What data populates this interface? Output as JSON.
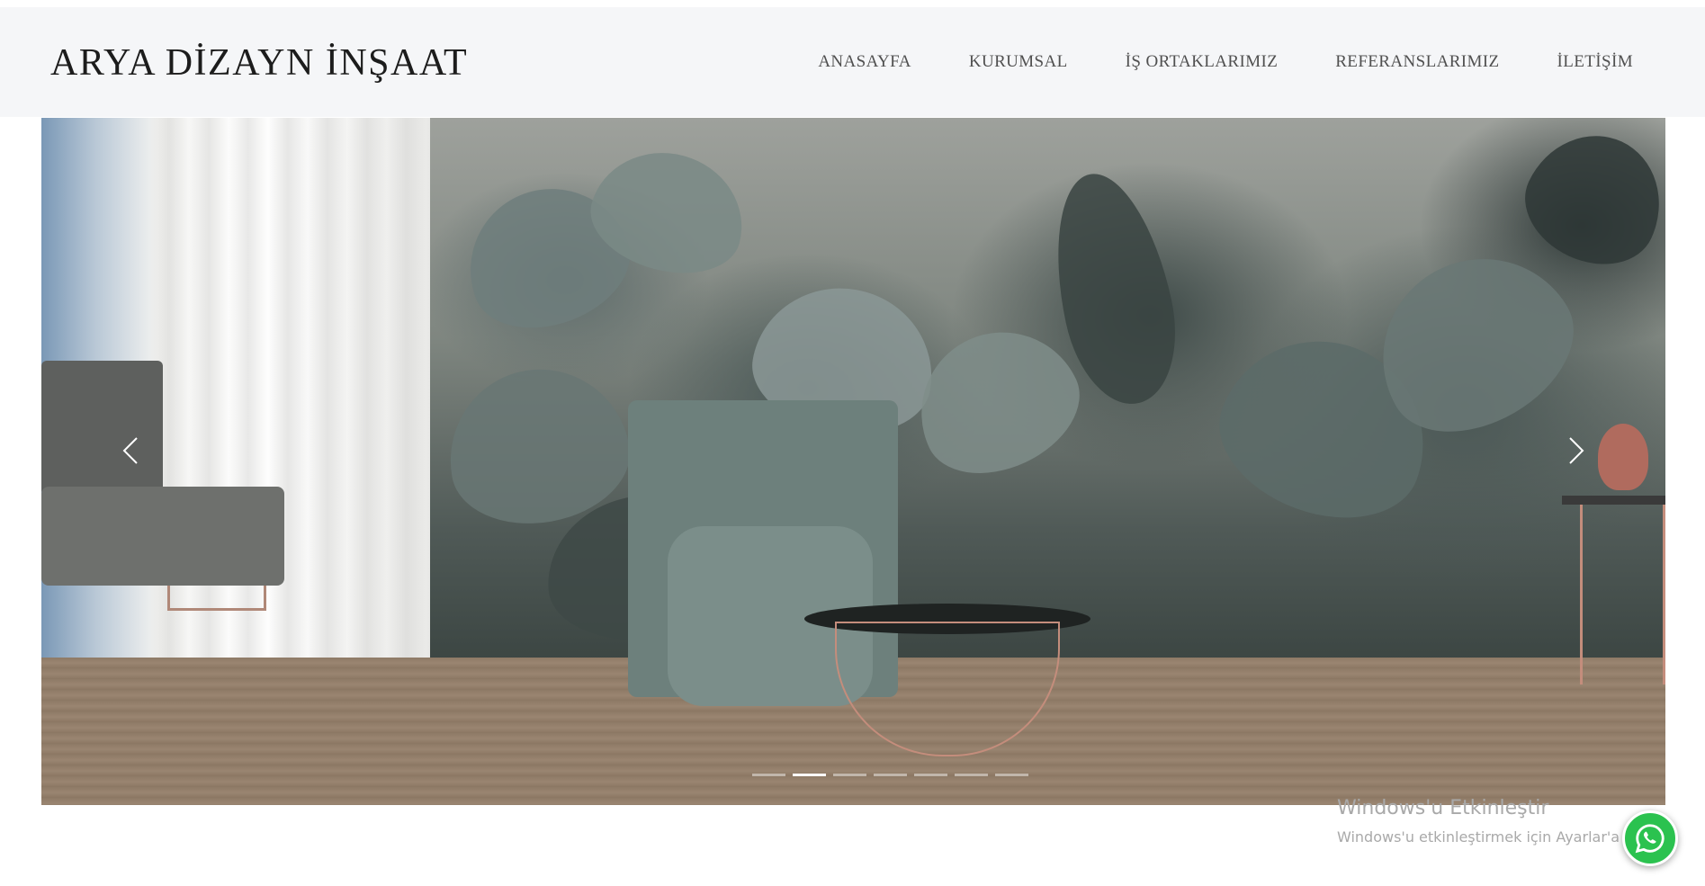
{
  "header": {
    "brand": "ARYA DİZAYN İNŞAAT",
    "nav": [
      {
        "label": "ANASAYFA"
      },
      {
        "label": "KURUMSAL"
      },
      {
        "label": "İŞ ORTAKLARIMIZ"
      },
      {
        "label": "REFERANSLARIMIZ"
      },
      {
        "label": "İLETİŞİM"
      }
    ]
  },
  "slider": {
    "image": "living-room-jungle-mural",
    "prev_icon": "chevron-left-icon",
    "next_icon": "chevron-right-icon",
    "slide_count": 7,
    "active_slide_index": 1
  },
  "overlay": {
    "watermark_title": "Windows'u Etkinleştir",
    "watermark_subtitle": "Windows'u etkinleştirmek için Ayarlar'a gi"
  },
  "whatsapp": {
    "icon": "whatsapp-icon",
    "color": "#2bc24f"
  }
}
